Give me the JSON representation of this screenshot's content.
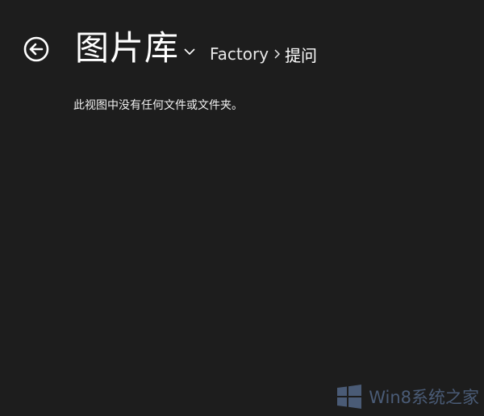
{
  "colors": {
    "background": "#1d1d1d",
    "text": "#ffffff",
    "watermark": "#6f8fbf"
  },
  "header": {
    "back_icon": "back-arrow-circle-icon",
    "title": "图片库",
    "title_dropdown_icon": "chevron-down-icon",
    "breadcrumb": {
      "parent": "Factory",
      "separator_icon": "chevron-right-icon",
      "current": "提问"
    }
  },
  "content": {
    "empty_message": "此视图中没有任何文件或文件夹。"
  },
  "watermark": {
    "logo_icon": "windows-logo-icon",
    "text": "Win8系统之家"
  }
}
